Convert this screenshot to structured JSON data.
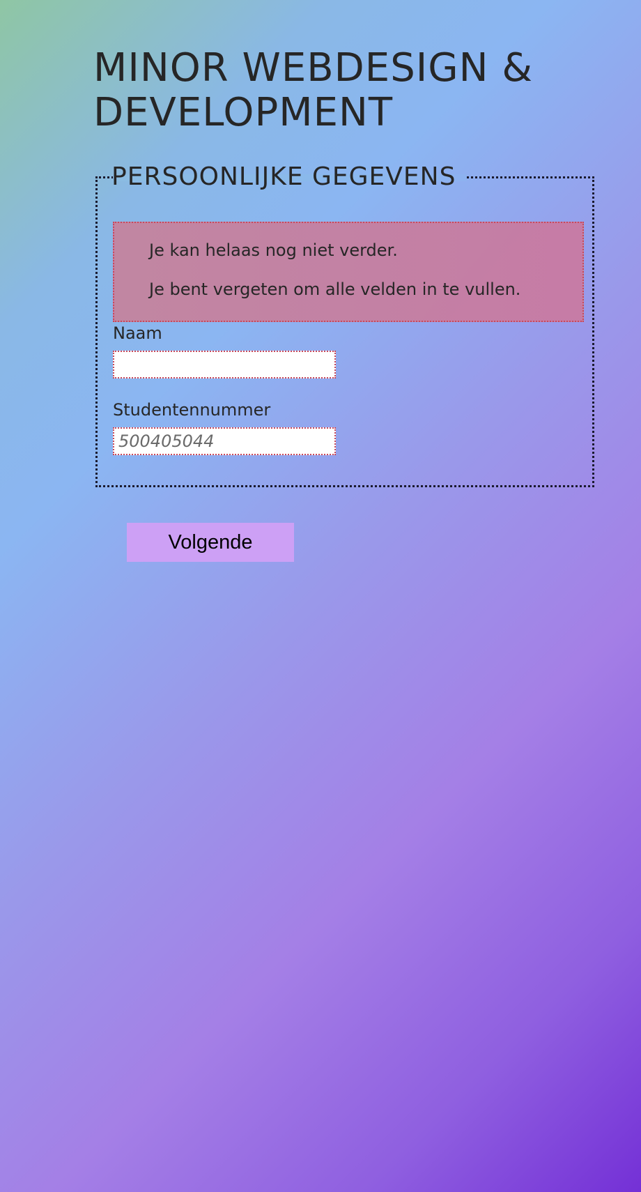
{
  "page": {
    "title": "MINOR WEBDESIGN & DEVELOPMENT"
  },
  "form": {
    "legend": "PERSOONLIJKE GEGEVENS",
    "errors": [
      "Je kan helaas nog niet verder.",
      "Je bent vergeten om alle velden in te vullen."
    ],
    "fields": {
      "naam": {
        "label": "Naam",
        "value": "",
        "placeholder": ""
      },
      "studentennummer": {
        "label": "Studentennummer",
        "value": "",
        "placeholder": "500405044"
      }
    },
    "next_label": "Volgende"
  },
  "colors": {
    "error_border": "#c8485a",
    "error_background": "#c684a0",
    "button_background": "#cda0f5",
    "text": "#262626"
  }
}
